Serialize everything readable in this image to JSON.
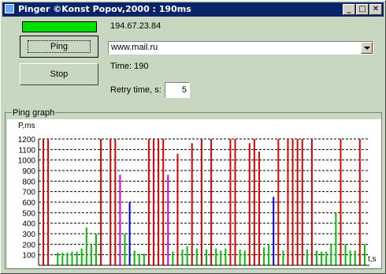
{
  "window": {
    "title": "Pinger ©Konst Popov,2000 : 190ms"
  },
  "status": {
    "ip": "194.67.23.84",
    "time_text": "Time: 190",
    "progress": 1.0
  },
  "buttons": {
    "ping": "Ping",
    "stop": "Stop"
  },
  "host_combo": {
    "value": "www.mail.ru"
  },
  "retry": {
    "label": "Retry time, s:",
    "value": "5"
  },
  "graph": {
    "group_title": "Ping graph",
    "ylabel": "P,ms",
    "xlabel": "t,s",
    "y_ticks": [
      "1200",
      "1100",
      "1000",
      "900",
      "800",
      "700",
      "600",
      "500",
      "400",
      "300",
      "200",
      "100"
    ],
    "colors": {
      "green": "#00c000",
      "red": "#e00000",
      "magenta": "#d000d0",
      "blue": "#0000c0"
    }
  },
  "chart_data": {
    "type": "bar",
    "ylim": [
      0,
      1200
    ],
    "grid": true,
    "values": [
      1200,
      1200,
      0,
      120,
      120,
      120,
      130,
      130,
      160,
      360,
      200,
      300,
      1200,
      0,
      1200,
      1200,
      860,
      300,
      600,
      140,
      110,
      110,
      1200,
      1200,
      1200,
      1200,
      860,
      130,
      1060,
      150,
      180,
      1160,
      160,
      1200,
      150,
      1200,
      160,
      140,
      160,
      1200,
      1200,
      150,
      140,
      1160,
      1200,
      1080,
      170,
      200,
      650,
      1200,
      140,
      1200,
      1200,
      1200,
      1200,
      150,
      1200,
      140,
      130,
      130,
      200,
      500,
      1200,
      200,
      140,
      140,
      1200,
      200
    ],
    "colors": [
      "red",
      "red",
      "green",
      "green",
      "green",
      "green",
      "green",
      "green",
      "green",
      "green",
      "green",
      "green",
      "red",
      "green",
      "red",
      "red",
      "magenta",
      "green",
      "blue",
      "green",
      "green",
      "green",
      "red",
      "red",
      "red",
      "red",
      "magenta",
      "green",
      "red",
      "green",
      "green",
      "red",
      "green",
      "red",
      "green",
      "red",
      "green",
      "green",
      "green",
      "red",
      "red",
      "green",
      "green",
      "red",
      "red",
      "red",
      "green",
      "green",
      "blue",
      "red",
      "green",
      "red",
      "red",
      "red",
      "red",
      "green",
      "red",
      "green",
      "green",
      "green",
      "green",
      "green",
      "red",
      "green",
      "green",
      "green",
      "red",
      "green"
    ]
  }
}
